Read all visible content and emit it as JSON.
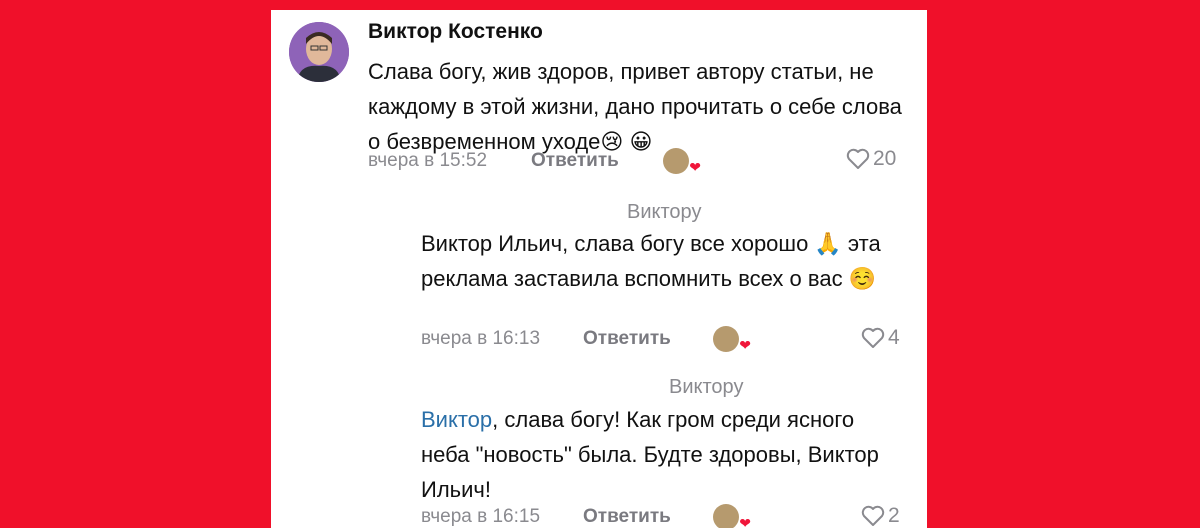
{
  "comments": [
    {
      "author": "Виктор Костенко",
      "text": "Слава богу, жив здоров, привет автору статьи, не каждому в этой жизни, дано прочитать о себе слова о безвременном уходе😢 😀",
      "time": "вчера в 15:52",
      "reply_label": "Ответить",
      "likes": "20"
    },
    {
      "reply_to": "Виктору",
      "text": "Виктор Ильич, слава богу все хорошо 🙏 эта реклама заставила вспомнить всех о вас ☺️",
      "time": "вчера в 16:13",
      "reply_label": "Ответить",
      "likes": "4"
    },
    {
      "reply_to": "Виктору",
      "mention": "Виктор",
      "text": ", слава богу! Как гром среди ясного неба \"новость\" была. Будте здоровы, Виктор Ильич!",
      "time": "вчера в 16:15",
      "reply_label": "Ответить",
      "likes": "2"
    }
  ],
  "colors": {
    "background": "#f0102a",
    "mention": "#2a6fa8",
    "heart": "#f0163a"
  },
  "icons": [
    "avatar",
    "reaction-badge-icon",
    "heart-outline-icon"
  ]
}
